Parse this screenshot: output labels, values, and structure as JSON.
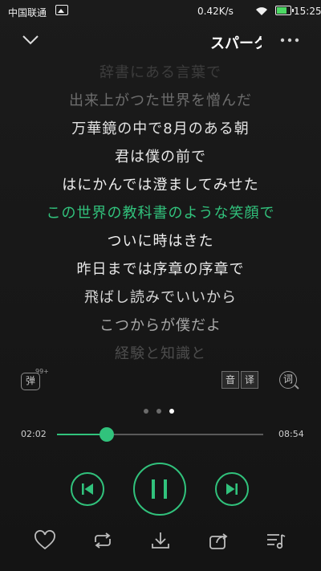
{
  "status_bar": {
    "carrier": "中国联通",
    "net_speed": "0.42K/s",
    "time": "15:25"
  },
  "header": {
    "title": "スパークル",
    "back_icon": "chevron-down-icon",
    "more_icon": "more-icon"
  },
  "lyrics": {
    "lines": [
      "辞書にある言葉で",
      "出来上がつた世界を憎んだ",
      "万華鏡の中で8月のある朝",
      "君は僕の前で",
      "はにかんでは澄ましてみせた",
      "この世界の教科書のような笑顔で",
      "ついに時はきた",
      "昨日までは序章の序章で",
      "飛ばし読みでいいから",
      "こつからが僕だよ",
      "経験と知識と"
    ],
    "active_index": 5,
    "active_color": "#31c27c"
  },
  "tools": {
    "danmaku_label": "弹",
    "danmaku_badge": "99+",
    "translate_labels": [
      "音",
      "译"
    ],
    "lyric_label": "词"
  },
  "pager": {
    "count": 3,
    "active": 2
  },
  "progress": {
    "current_time": "02:02",
    "total_time": "08:54",
    "fraction": 0.24,
    "accent": "#31c27c"
  },
  "controls": {
    "prev_icon": "previous-icon",
    "play_state": "playing",
    "pause_icon": "pause-icon",
    "next_icon": "next-icon"
  },
  "bottom_bar": {
    "icons": [
      "heart-icon",
      "repeat-icon",
      "download-icon",
      "share-icon",
      "playlist-icon"
    ]
  }
}
